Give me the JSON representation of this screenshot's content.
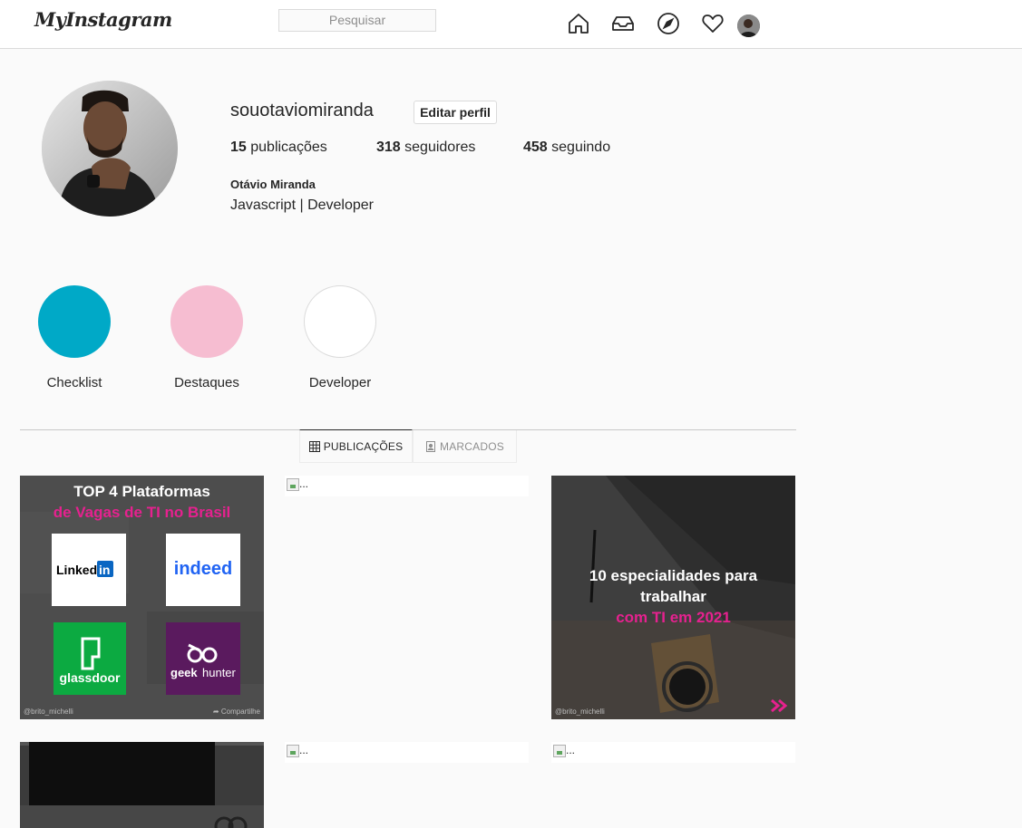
{
  "header": {
    "logo": "MyInstagram",
    "search_placeholder": "Pesquisar",
    "icons": [
      "home-icon",
      "inbox-icon",
      "explore-icon",
      "heart-icon",
      "profile-avatar"
    ]
  },
  "profile": {
    "username": "souotaviomiranda",
    "edit_button": "Editar perfil",
    "stats": [
      {
        "count": "15",
        "label": "publicações"
      },
      {
        "count": "318",
        "label": "seguidores"
      },
      {
        "count": "458",
        "label": "seguindo"
      }
    ],
    "full_name": "Otávio Miranda",
    "bio": "Javascript | Developer"
  },
  "highlights": [
    {
      "label": "Checklist",
      "color": "#00a9c7"
    },
    {
      "label": "Destaques",
      "color": "#f6bdd1"
    },
    {
      "label": "Developer",
      "color": "#ffffff"
    }
  ],
  "tabs": [
    {
      "label": "PUBLICAÇÕES",
      "active": true
    },
    {
      "label": "MARCADOS",
      "active": false
    }
  ],
  "posts": {
    "post1": {
      "title_line1": "TOP 4  Plataformas",
      "title_line2": "de Vagas  de TI no Brasil",
      "logos": [
        "Linked",
        "in",
        "indeed",
        "glassdoor",
        "geek",
        "hunter"
      ],
      "handle": "@brito_michelli",
      "share": "Compartilhe"
    },
    "post3": {
      "line1": "10 especialidades para",
      "line2": "trabalhar",
      "line3": "com TI em 2021",
      "handle": "@brito_michelli"
    },
    "broken_alt": "..."
  },
  "colors": {
    "accent_pink": "#e6218f",
    "linkedin_blue": "#0a66c2",
    "glassdoor_green": "#0caa41",
    "geekhunter_purple": "#5a1a5e"
  }
}
